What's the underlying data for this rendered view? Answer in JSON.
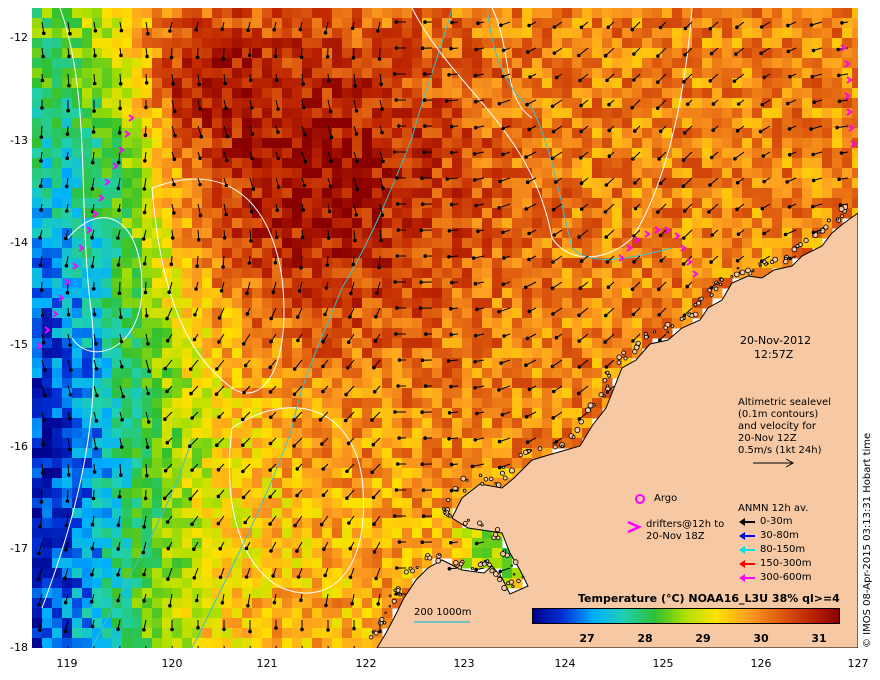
{
  "map": {
    "y_ticks": [
      "-12",
      "-13",
      "-14",
      "-15",
      "-16",
      "-17",
      "-18"
    ],
    "x_ticks": [
      "119",
      "120",
      "121",
      "122",
      "123",
      "124",
      "125",
      "126",
      "127"
    ],
    "lon_range": [
      118.6,
      127.0
    ],
    "lat_range": [
      -18.0,
      -11.8
    ],
    "land_color": "#f6c8a4",
    "coast_color": "#000000",
    "contour_color": "#ffffff",
    "isobath_color": "#40c0c8",
    "drifter_color": "#ff00ff"
  },
  "annotations": {
    "date": "20-Nov-2012",
    "time": "12:57Z",
    "altimetry_1": "Altimetric sealevel",
    "altimetry_2": "(0.1m contours)",
    "altimetry_3": "and velocity for",
    "altimetry_4": "20-Nov 12Z",
    "altimetry_5": "0.5m/s (1kt 24h)",
    "argo_label": "Argo",
    "drifters_1": "drifters@12h to",
    "drifters_2": "20-Nov 18Z",
    "isobath_label": "200  1000m"
  },
  "anmn_legend": {
    "title": "ANMN 12h av.",
    "items": [
      {
        "label": "0-30m",
        "color": "#000000"
      },
      {
        "label": "30-80m",
        "color": "#0000ff"
      },
      {
        "label": "80-150m",
        "color": "#00e0e0"
      },
      {
        "label": "150-300m",
        "color": "#ff0000"
      },
      {
        "label": "300-600m",
        "color": "#ff00ff"
      }
    ]
  },
  "colorbar": {
    "title": "Temperature (°C) NOAA16_L3U 38% ql>=4",
    "ticks": [
      "27",
      "28",
      "29",
      "30",
      "31"
    ],
    "range": [
      26.0,
      31.3
    ]
  },
  "credit": "© IMOS 08-Apr-2015 03:13:31 Hobart time"
}
